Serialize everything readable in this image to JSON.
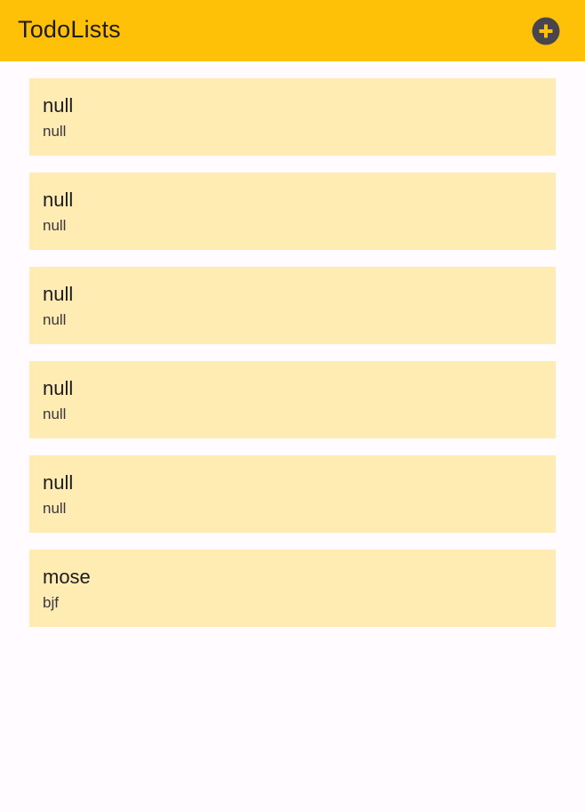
{
  "appbar": {
    "title": "TodoLists",
    "add_icon": "add-circle-icon",
    "background_color": "#FFC107",
    "icon_color": "#49454F"
  },
  "lists": [
    {
      "title": "null",
      "subtitle": "null"
    },
    {
      "title": "null",
      "subtitle": "null"
    },
    {
      "title": "null",
      "subtitle": "null"
    },
    {
      "title": "null",
      "subtitle": "null"
    },
    {
      "title": "null",
      "subtitle": "null"
    },
    {
      "title": "mose",
      "subtitle": "bjf"
    }
  ],
  "card_color": "#FFECB3",
  "page_background": "#FFFBFE"
}
